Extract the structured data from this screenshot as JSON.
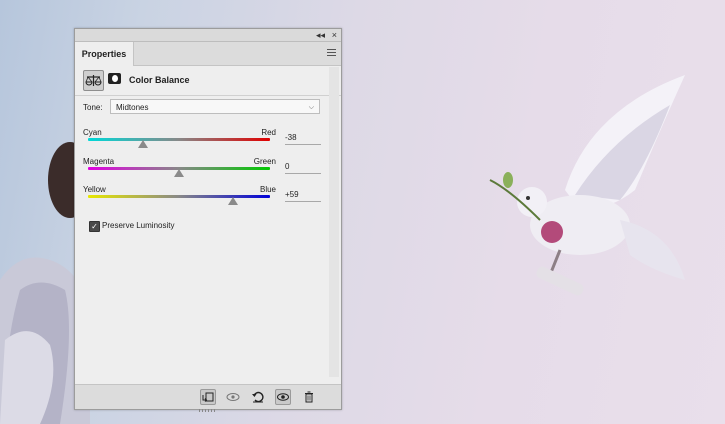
{
  "panel": {
    "tab_label": "Properties",
    "collapse_icon": "double-chevron-left-icon",
    "close_icon": "close-icon",
    "menu_icon": "panel-menu-icon"
  },
  "header": {
    "title": "Color Balance",
    "adjustment_icon": "color-balance-scale-icon",
    "mask_icon": "layer-mask-icon"
  },
  "tone": {
    "label": "Tone:",
    "value": "Midtones"
  },
  "sliders": [
    {
      "left_label": "Cyan",
      "right_label": "Red",
      "value": "-38",
      "position": 0.3,
      "left_color": "#00d8d8",
      "right_color": "#e00000"
    },
    {
      "left_label": "Magenta",
      "right_label": "Green",
      "value": "0",
      "position": 0.5,
      "left_color": "#e000e0",
      "right_color": "#00c800"
    },
    {
      "left_label": "Yellow",
      "right_label": "Blue",
      "value": "+59",
      "position": 0.795,
      "left_color": "#e8e800",
      "right_color": "#0000d8"
    }
  ],
  "preserve": {
    "label": "Preserve Luminosity",
    "checked": true
  },
  "bottom_icons": [
    "clip-to-layer-icon",
    "view-previous-state-icon",
    "reset-icon",
    "visibility-eye-icon",
    "trash-icon"
  ]
}
